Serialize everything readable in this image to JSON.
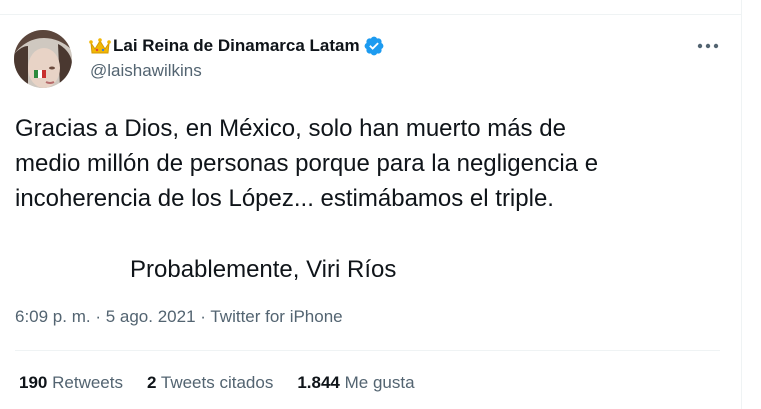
{
  "author": {
    "display_name": "Lai Reina de Dinamarca Latam",
    "handle": "@laishawilkins",
    "badge_icon": "crown-icon",
    "verified_icon": "verified-badge-icon",
    "verified_color": "#1d9bf0"
  },
  "tweet": {
    "lines": [
      "Gracias a Dios, en México, solo han muerto más de",
      "medio millón de personas porque para la negligencia e",
      "incoherencia de los López... estimábamos el triple."
    ],
    "signature": "Probablemente, Viri Ríos"
  },
  "meta": {
    "time": "6:09 p. m.",
    "sep1": " · ",
    "date": "5 ago. 2021",
    "sep2": " · ",
    "source": "Twitter for iPhone"
  },
  "stats": {
    "retweets": {
      "count": "190",
      "label": "Retweets"
    },
    "quotes": {
      "count": "2",
      "label": "Tweets citados"
    },
    "likes": {
      "count": "1.844",
      "label": "Me gusta"
    }
  },
  "colors": {
    "text_primary": "#0f1419",
    "text_secondary": "#536471",
    "border": "#eff3f4"
  }
}
